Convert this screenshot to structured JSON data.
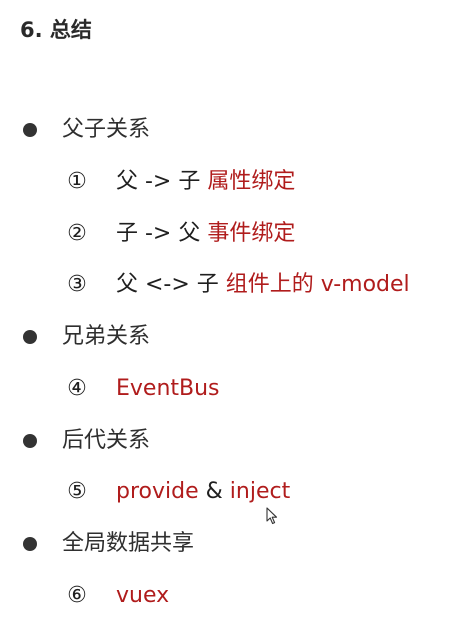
{
  "title": "6. 总结",
  "sections": [
    {
      "heading": "父子关系",
      "items": [
        {
          "marker": "①",
          "prefix": "父 -> 子 ",
          "highlight": "属性绑定"
        },
        {
          "marker": "②",
          "prefix": "子 -> 父 ",
          "highlight": "事件绑定"
        },
        {
          "marker": "③",
          "prefix": "父 <-> 子 ",
          "highlight": "组件上的 v-model"
        }
      ]
    },
    {
      "heading": "兄弟关系",
      "items": [
        {
          "marker": "④",
          "highlight": "EventBus"
        }
      ]
    },
    {
      "heading": "后代关系",
      "items": [
        {
          "marker": "⑤",
          "highlight": "provide",
          "joiner": " & ",
          "highlight2": "inject"
        }
      ]
    },
    {
      "heading": "全局数据共享",
      "items": [
        {
          "marker": "⑥",
          "highlight": "vuex"
        }
      ]
    }
  ],
  "colors": {
    "accent_red": "#b01c1c",
    "text": "#1f1f1f",
    "bullet": "#333333"
  },
  "icons": {
    "cursor": "mouse-pointer-icon",
    "bullet": "filled-circle-bullet"
  }
}
